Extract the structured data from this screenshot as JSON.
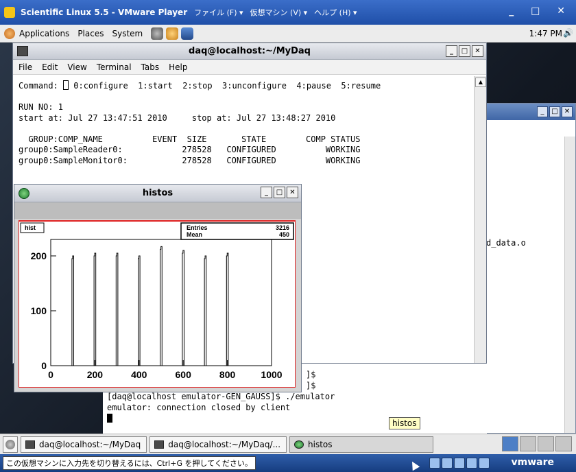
{
  "vmware": {
    "title": "Scientific Linux 5.5 - VMware Player",
    "menus": [
      "ファイル (F) ▾",
      "仮想マシン (V) ▾",
      "ヘルプ (H) ▾"
    ],
    "controls": "_ □ ✕",
    "status_hint": "この仮想マシンに入力先を切り替えるには、Ctrl+G を押してください。",
    "brand": "vmware"
  },
  "panel": {
    "menus": [
      "Applications",
      "Places",
      "System"
    ],
    "clock": "1:47 PM"
  },
  "terminal": {
    "title": "daq@localhost:~/MyDaq",
    "menu": [
      "File",
      "Edit",
      "View",
      "Terminal",
      "Tabs",
      "Help"
    ],
    "command_prefix": "Command: ",
    "command_options": " 0:configure  1:start  2:stop  3:unconfigure  4:pause  5:resume",
    "run_line": "RUN NO: 1",
    "times_line": "start at: Jul 27 13:47:51 2010     stop at: Jul 27 13:48:27 2010",
    "table_header": "  GROUP:COMP_NAME          EVENT  SIZE       STATE        COMP STATUS",
    "rows": [
      "group0:SampleReader0:            278528   CONFIGURED          WORKING",
      "group0:SampleMonitor0:           278528   CONFIGURED          WORKING"
    ]
  },
  "lower_terminal": {
    "partial_1": "]$",
    "partial_2": "]$",
    "line_cmd": "[daq@localhost emulator-GEN_GAUSS]$ ./emulator",
    "line_msg": "emulator: connection closed by client"
  },
  "background_window": {
    "file_fragment": "d_data.o"
  },
  "tooltip": "histos",
  "histos": {
    "title": "histos",
    "hist_label": "hist",
    "stats": {
      "entries_label": "Entries",
      "entries_value": "3216",
      "mean_label": "Mean",
      "mean_value": "450"
    }
  },
  "chart_data": {
    "type": "bar",
    "title": "hist",
    "xlim": [
      0,
      1000
    ],
    "ylim": [
      0,
      230
    ],
    "xticks": [
      "0",
      "200",
      "400",
      "600",
      "800",
      "1000"
    ],
    "yticks": [
      "0",
      "100",
      "200"
    ],
    "peaks": [
      {
        "x": 100,
        "height": 200
      },
      {
        "x": 200,
        "height": 205
      },
      {
        "x": 300,
        "height": 205
      },
      {
        "x": 400,
        "height": 200
      },
      {
        "x": 500,
        "height": 217
      },
      {
        "x": 600,
        "height": 210
      },
      {
        "x": 700,
        "height": 200
      },
      {
        "x": 800,
        "height": 205
      }
    ]
  },
  "taskbar": {
    "items": [
      "daq@localhost:~/MyDaq",
      "daq@localhost:~/MyDaq/...",
      "histos"
    ]
  }
}
